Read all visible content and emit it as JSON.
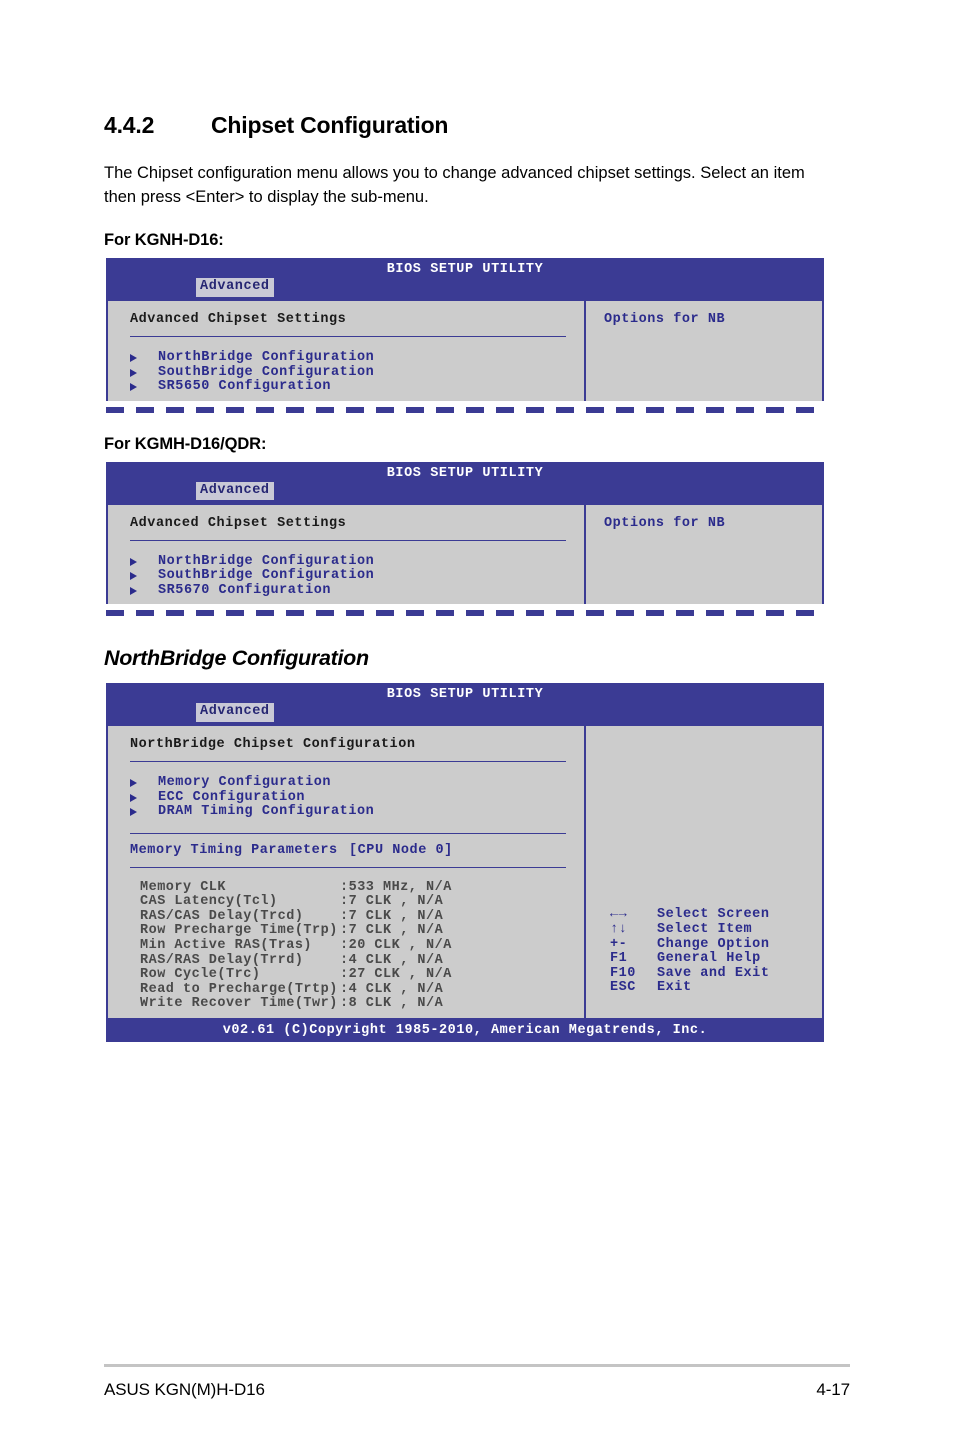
{
  "section": {
    "number": "4.4.2",
    "title": "Chipset Configuration",
    "intro": "The Chipset configuration menu allows you to change advanced chipset settings. Select an item then press <Enter> to display the sub-menu."
  },
  "labels": {
    "for_kgnh": "For KGNH-D16:",
    "for_kgmh": "For KGMH-D16/QDR:",
    "northbridge_heading": "NorthBridge Configuration"
  },
  "bios_common": {
    "title": "BIOS SETUP UTILITY",
    "tab": "Advanced",
    "footer": "v02.61 (C)Copyright 1985-2010, American Megatrends, Inc."
  },
  "screen1": {
    "panel_title": "Advanced Chipset Settings",
    "menu": [
      "NorthBridge Configuration",
      "SouthBridge Configuration",
      "SR5650 Configuration"
    ],
    "help": "Options for NB"
  },
  "screen2": {
    "panel_title": "Advanced Chipset Settings",
    "menu": [
      "NorthBridge Configuration",
      "SouthBridge Configuration",
      "SR5670 Configuration"
    ],
    "help": "Options for NB"
  },
  "screen3": {
    "panel_title": "NorthBridge Chipset Configuration",
    "menu": [
      "Memory Configuration",
      "ECC Configuration",
      "DRAM Timing Configuration"
    ],
    "timing_row": {
      "name": "Memory Timing Parameters",
      "value": "[CPU Node 0]"
    },
    "params": [
      {
        "name": "Memory CLK",
        "value": ":533 MHz, N/A"
      },
      {
        "name": "CAS Latency(Tcl)",
        "value": ":7 CLK , N/A"
      },
      {
        "name": "RAS/CAS Delay(Trcd)",
        "value": ":7 CLK , N/A"
      },
      {
        "name": "Row Precharge Time(Trp)",
        "value": ":7 CLK , N/A"
      },
      {
        "name": "Min Active RAS(Tras)",
        "value": ":20 CLK , N/A"
      },
      {
        "name": "RAS/RAS Delay(Trrd)",
        "value": ":4 CLK , N/A"
      },
      {
        "name": "Row Cycle(Trc)",
        "value": ":27 CLK , N/A"
      },
      {
        "name": "Read to Precharge(Trtp)",
        "value": ":4 CLK , N/A"
      },
      {
        "name": "Write Recover Time(Twr)",
        "value": ":8 CLK , N/A"
      }
    ],
    "keys": [
      {
        "key": "←→",
        "action": "Select Screen"
      },
      {
        "key": "↑↓",
        "action": "Select Item"
      },
      {
        "key": "+-",
        "action": "Change Option"
      },
      {
        "key": "F1",
        "action": "General Help"
      },
      {
        "key": "F10",
        "action": "Save and Exit"
      },
      {
        "key": "ESC",
        "action": "Exit"
      }
    ]
  },
  "page_footer": {
    "product": "ASUS KGN(M)H-D16",
    "page_number": "4-17"
  },
  "colors": {
    "bios_blue": "#3b3b94",
    "bios_gray": "#cccccc",
    "menu_blue": "#2b2b8c",
    "tab_bg": "#c9c9d6"
  }
}
